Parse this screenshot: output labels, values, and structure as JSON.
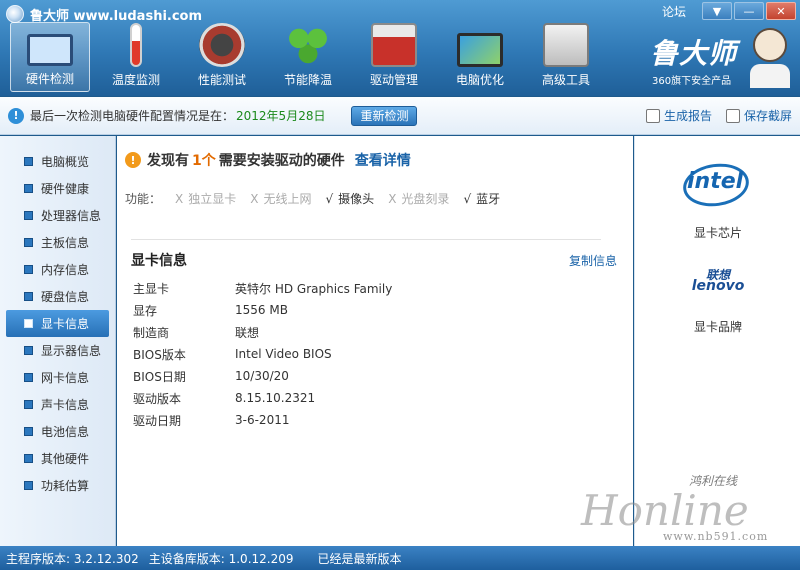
{
  "app": {
    "title": "鲁大师 www.ludashi.com",
    "forum": "论坛",
    "min": "—",
    "max": "▼",
    "close": "✕"
  },
  "toolbar": {
    "items": [
      {
        "label": "硬件检测",
        "icon": "monitor-magnifier-icon"
      },
      {
        "label": "温度监测",
        "icon": "thermometer-icon"
      },
      {
        "label": "性能测试",
        "icon": "gauge-icon"
      },
      {
        "label": "节能降温",
        "icon": "clover-icon"
      },
      {
        "label": "驱动管理",
        "icon": "toolbox-icon"
      },
      {
        "label": "电脑优化",
        "icon": "screen-icon"
      },
      {
        "label": "高级工具",
        "icon": "computer-case-icon"
      }
    ],
    "active_index": 0
  },
  "brand": {
    "name": "鲁大师",
    "subtitle": "360旗下安全产品"
  },
  "infobar": {
    "text": "最后一次检测电脑硬件配置情况是在：",
    "date": "2012年5月28日",
    "recheck": "重新检测",
    "report": "生成报告",
    "screenshot": "保存截屏"
  },
  "sidebar": {
    "items": [
      "电脑概览",
      "硬件健康",
      "处理器信息",
      "主板信息",
      "内存信息",
      "硬盘信息",
      "显卡信息",
      "显示器信息",
      "网卡信息",
      "声卡信息",
      "电池信息",
      "其他硬件",
      "功耗估算"
    ],
    "active_index": 6
  },
  "main": {
    "alert_prefix": "发现有",
    "alert_count": "1个",
    "alert_suffix": "需要安装驱动的硬件",
    "alert_link": "查看详情",
    "features_label": "功能：",
    "features": [
      {
        "mark": "X",
        "label": "独立显卡",
        "on": false
      },
      {
        "mark": "X",
        "label": "无线上网",
        "on": false
      },
      {
        "mark": "√",
        "label": "摄像头",
        "on": true
      },
      {
        "mark": "X",
        "label": "光盘刻录",
        "on": false
      },
      {
        "mark": "√",
        "label": "蓝牙",
        "on": true
      }
    ],
    "section_title": "显卡信息",
    "copy_link": "复制信息",
    "props": [
      {
        "k": "主显卡",
        "v": "英特尔 HD Graphics Family"
      },
      {
        "k": "显存",
        "v": "1556 MB"
      },
      {
        "k": "制造商",
        "v": "联想"
      },
      {
        "k": "BIOS版本",
        "v": "Intel Video BIOS"
      },
      {
        "k": "BIOS日期",
        "v": "10/30/20"
      },
      {
        "k": "驱动版本",
        "v": "8.15.10.2321"
      },
      {
        "k": "驱动日期",
        "v": "3-6-2011"
      }
    ]
  },
  "rpanel": {
    "intel_logo": "intel",
    "chip_caption": "显卡芯片",
    "lenovo_cn": "联想",
    "lenovo_en": "lenovo",
    "brand_caption": "显卡品牌"
  },
  "watermark": {
    "line1": "鸿利在线",
    "line2": "Honline",
    "line3": "www.nb591.com"
  },
  "status": {
    "main_version": "主程序版本: 3.2.12.302",
    "db_version": "主设备库版本: 1.0.12.209",
    "latest": "已经是最新版本"
  }
}
